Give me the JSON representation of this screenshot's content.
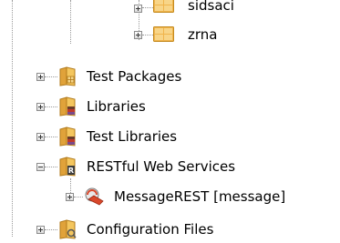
{
  "tree": {
    "items": [
      {
        "label": "sidsaci",
        "icon": "package-icon",
        "state": "collapsed"
      },
      {
        "label": "zrna",
        "icon": "package-icon",
        "state": "collapsed"
      },
      {
        "label": "Test Packages",
        "icon": "test-packages-folder-icon",
        "state": "collapsed"
      },
      {
        "label": "Libraries",
        "icon": "libraries-folder-icon",
        "state": "collapsed"
      },
      {
        "label": "Test Libraries",
        "icon": "test-libraries-folder-icon",
        "state": "collapsed"
      },
      {
        "label": "RESTful Web Services",
        "icon": "restful-services-folder-icon",
        "state": "expanded"
      },
      {
        "label": "MessageREST [message]",
        "icon": "rest-service-icon",
        "state": "collapsed"
      },
      {
        "label": "Configuration Files",
        "icon": "configuration-folder-icon",
        "state": "collapsed"
      }
    ]
  },
  "colors": {
    "folder": "#f2c45a",
    "package": "#f0b44c",
    "guide_line": "#9a9a9a",
    "rest_accent": "#d9482b"
  }
}
